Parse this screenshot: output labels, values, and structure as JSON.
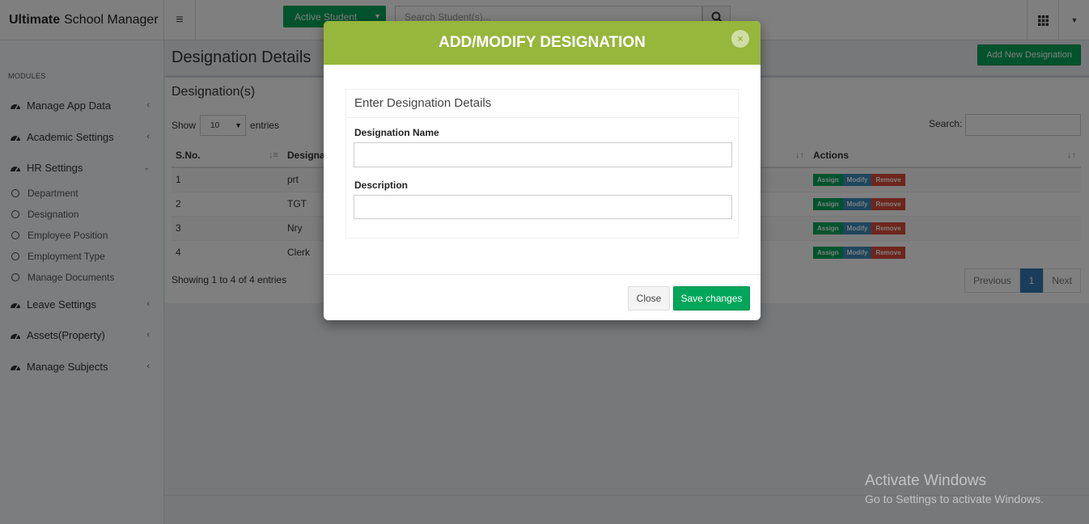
{
  "header": {
    "brand_bold": "Ultimate",
    "brand_rest": "School Manager",
    "active_student_label": "Active Student",
    "search_placeholder": "Search Student(s)..."
  },
  "sidebar": {
    "section_label": "MODULES",
    "items": [
      {
        "label": "Manage App Data"
      },
      {
        "label": "Academic Settings"
      },
      {
        "label": "HR Settings"
      },
      {
        "label": "Leave Settings"
      },
      {
        "label": "Assets(Property)"
      },
      {
        "label": "Manage Subjects"
      }
    ],
    "hr_sub": [
      {
        "label": "Department"
      },
      {
        "label": "Designation"
      },
      {
        "label": "Employee Position"
      },
      {
        "label": "Employment Type"
      },
      {
        "label": "Manage Documents"
      }
    ]
  },
  "main": {
    "page_title": "Designation Details",
    "add_new_label": "Add New Designation",
    "box_title": "Designation(s)",
    "show_label": "Show",
    "entries_value": "10",
    "entries_label": "entries",
    "search_label": "Search:",
    "columns": [
      "S.No.",
      "Designat",
      "Actions"
    ],
    "rows": [
      {
        "sno": "1",
        "name": "prt"
      },
      {
        "sno": "2",
        "name": "TGT"
      },
      {
        "sno": "3",
        "name": "Nry"
      },
      {
        "sno": "4",
        "name": "Clerk"
      }
    ],
    "action_labels": {
      "assign": "Assign",
      "modify": "Modify",
      "remove": "Remove"
    },
    "showing_text": "Showing 1 to 4 of 4 entries",
    "pager": {
      "previous": "Previous",
      "current": "1",
      "next": "Next"
    }
  },
  "modal": {
    "title": "ADD/MODIFY DESIGNATION",
    "close_glyph": "×",
    "section_title": "Enter Designation Details",
    "name_label": "Designation Name",
    "description_label": "Description",
    "close_label": "Close",
    "save_label": "Save changes"
  },
  "watermark": {
    "title": "Activate Windows",
    "subtitle": "Go to Settings to activate Windows."
  },
  "colors": {
    "modal_header": "#96b63c",
    "primary_green": "#00a65a",
    "modify_blue": "#3c8dbc",
    "remove_red": "#dd4b39"
  }
}
